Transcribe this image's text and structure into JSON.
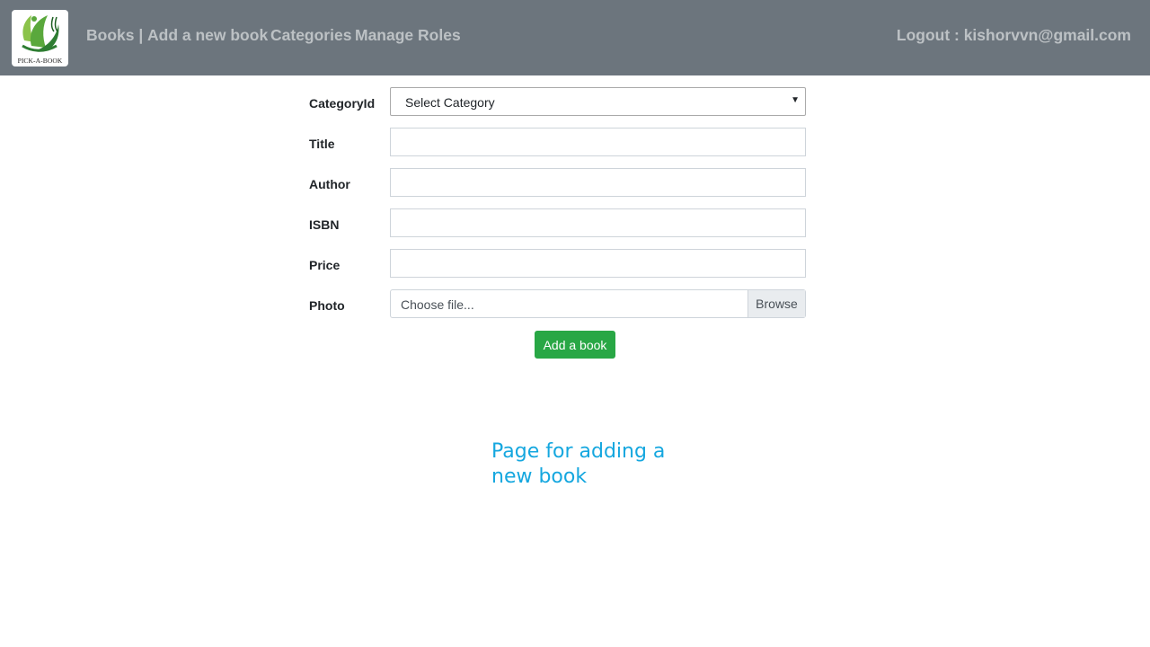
{
  "brand": {
    "logo_text": "PICK-A-BOOK",
    "logo_colors": [
      "#5aa83c",
      "#2e7d32",
      "#8bc34a"
    ]
  },
  "nav": {
    "books": "Books |",
    "add_book": "Add a new book",
    "categories": "Categories",
    "manage_roles": "Manage Roles",
    "logout": "Logout : kishorvvn@gmail.com"
  },
  "form": {
    "category": {
      "label": "CategoryId",
      "selected": "Select Category"
    },
    "title": {
      "label": "Title",
      "value": ""
    },
    "author": {
      "label": "Author",
      "value": ""
    },
    "isbn": {
      "label": "ISBN",
      "value": ""
    },
    "price": {
      "label": "Price",
      "value": ""
    },
    "photo": {
      "label": "Photo",
      "placeholder": "Choose file...",
      "browse": "Browse"
    },
    "submit": "Add a book"
  },
  "caption": "Page for adding a new book",
  "colors": {
    "navbar": "#6c757d",
    "submit": "#28a745",
    "caption": "#15a7df"
  }
}
